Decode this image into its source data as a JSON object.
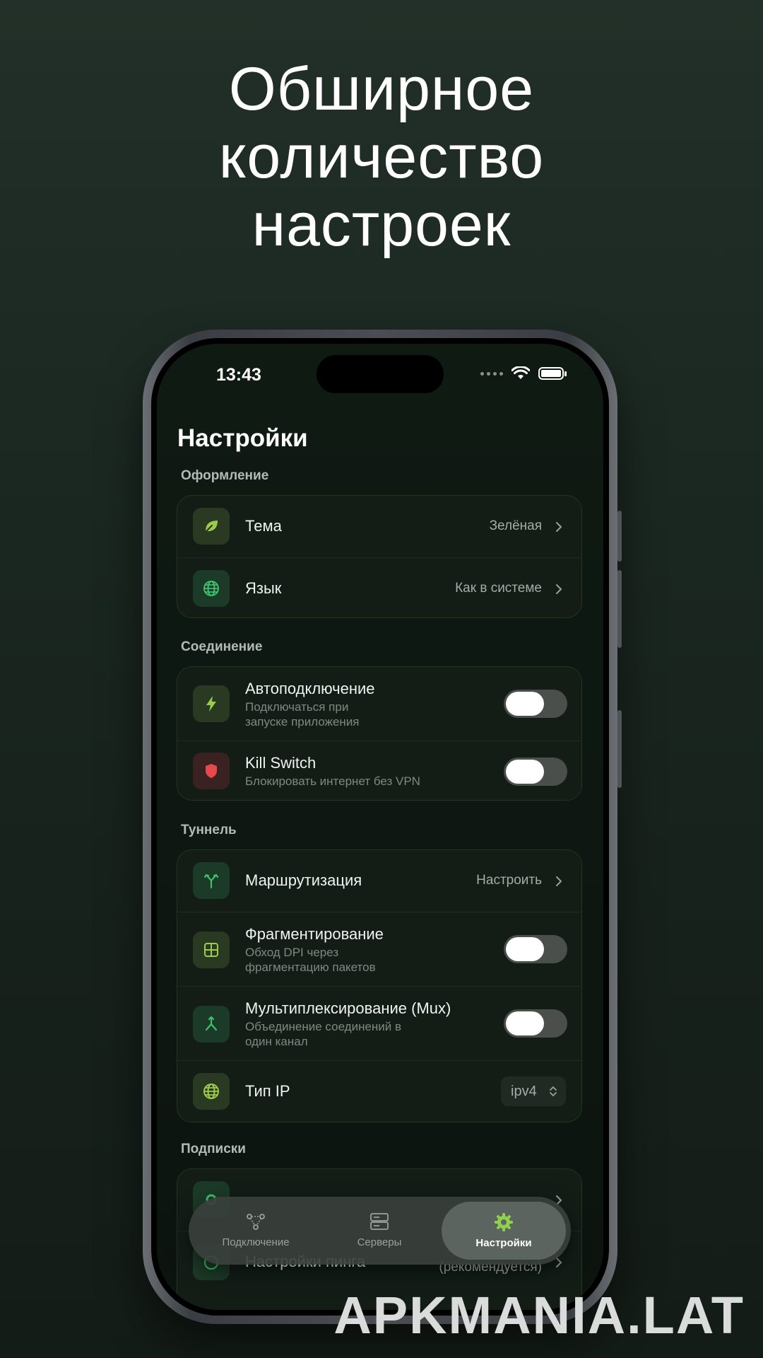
{
  "hero": {
    "line1": "Обширное",
    "line2": "количество",
    "line3": "настроек"
  },
  "status": {
    "time": "13:43"
  },
  "page": {
    "title": "Настройки"
  },
  "sections": {
    "appearance": {
      "label": "Оформление",
      "theme": {
        "title": "Тема",
        "value": "Зелёная",
        "icon": "leaf-icon"
      },
      "language": {
        "title": "Язык",
        "value": "Как в системе",
        "icon": "globe-icon"
      }
    },
    "connection": {
      "label": "Соединение",
      "autoconnect": {
        "title": "Автоподключение",
        "subtitle": "Подключаться при запуске приложения",
        "enabled": false,
        "icon": "bolt-icon"
      },
      "killswitch": {
        "title": "Kill Switch",
        "subtitle": "Блокировать интернет без VPN",
        "enabled": false,
        "icon": "shield-icon"
      }
    },
    "tunnel": {
      "label": "Туннель",
      "routing": {
        "title": "Маршрутизация",
        "value": "Настроить",
        "icon": "split-arrow-icon"
      },
      "fragmentation": {
        "title": "Фрагментирование",
        "subtitle": "Обход DPI через фрагментацию пакетов",
        "enabled": false,
        "icon": "grid-icon"
      },
      "mux": {
        "title": "Мультиплексирование (Mux)",
        "subtitle": "Объединение соединений в один канал",
        "enabled": false,
        "icon": "merge-arrow-icon"
      },
      "ip_type": {
        "title": "Тип IP",
        "value": "ipv4",
        "icon": "globe-icon"
      }
    },
    "subscriptions": {
      "label": "Подписки",
      "ping": {
        "title": "Настройки пинга",
        "value": "(рекомендуется)"
      }
    }
  },
  "tabbar": {
    "connection": "Подключение",
    "servers": "Серверы",
    "settings": "Настройки"
  },
  "watermark": "APKMANIA.LAT",
  "colors": {
    "accent": "#8fd14f",
    "card_bg": "#131d16",
    "danger": "#e5484d"
  }
}
